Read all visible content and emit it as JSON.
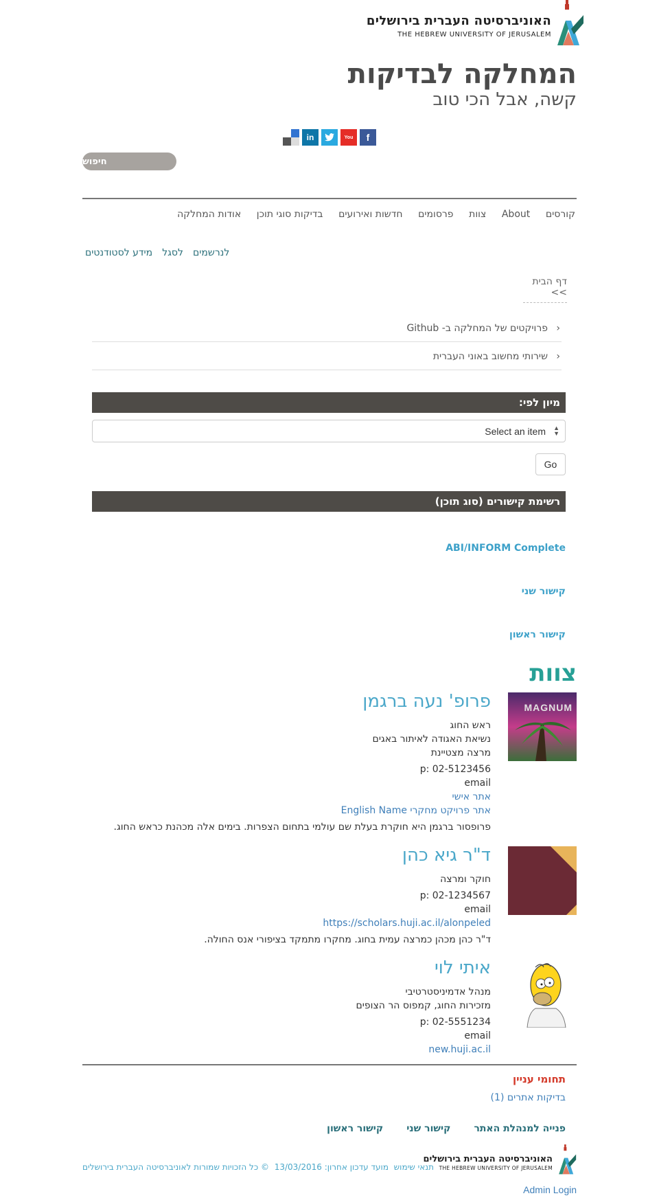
{
  "header": {
    "university_he": "האוניברסיטה העברית בירושלים",
    "university_en": "THE HEBREW UNIVERSITY OF JERUSALEM",
    "site_title": "המחלקה לבדיקות",
    "site_slogan": "קשה, אבל הכי טוב",
    "social": [
      {
        "icon": "facebook-icon",
        "glyph": "f",
        "color": "#3b5998"
      },
      {
        "icon": "youtube-icon",
        "glyph": "▶",
        "color": "#e52d27"
      },
      {
        "icon": "twitter-icon",
        "glyph": "t",
        "color": "#2aa9e0"
      },
      {
        "icon": "linkedin-icon",
        "glyph": "in",
        "color": "#0e76a8"
      },
      {
        "icon": "delicious-icon",
        "glyph": "",
        "color": "#3274d1"
      }
    ],
    "search_label": "חיפוש"
  },
  "main_nav": [
    "אודות המחלקה",
    "בדיקות סוגי תוכן",
    "חדשות ואירועים",
    "פרסומים",
    "צוות",
    "About",
    "קורסים"
  ],
  "secondary_nav": [
    "לנרשמים",
    "לסגל",
    "מידע לסטודנטים"
  ],
  "breadcrumb": "דף הבית >>",
  "side_menu": [
    "פרויקטים של המחלקה ב- Github",
    "שירותי מחשוב באוני העברית"
  ],
  "filter": {
    "title": "מיון לפי:",
    "select_value": "Select an item",
    "go_label": "Go"
  },
  "links_section": {
    "title": "רשימת קישורים (סוג תוכן)",
    "items": [
      "ABI/INFORM Complete",
      "קישור שני",
      "קישור ראשון"
    ]
  },
  "team": {
    "title": "צוות",
    "members": [
      {
        "name": "פרופ' נעה ברגמן",
        "photo_caption": "MAGNUM",
        "roles": [
          "ראש החוג",
          "נשיאת האגודה לאיתור באגים",
          "מרצה מצטיינת"
        ],
        "phone": "p: 02-5123456",
        "email": "email",
        "links": [
          "אתר אישי",
          "אתר פרויקט מחקרי English Name"
        ],
        "bio": "פרופסור ברגמן היא חוקרת בעלת שם עולמי בתחום הצפרות. בימים אלה מכהנת כראש החוג."
      },
      {
        "name": "ד\"ר גיא כהן",
        "roles": [
          "חוקר ומרצה"
        ],
        "phone": "p: 02-1234567",
        "email": "email",
        "links": [
          "https://scholars.huji.ac.il/alonpeled"
        ],
        "bio": "ד\"ר כהן מכהן כמרצה עמית בחוג. מחקרו מתמקד בציפורי אנס החולה."
      },
      {
        "name": "איתי לוי",
        "roles": [
          "מנהל אדמיניסטרטיבי",
          "מזכירות החוג, קמפוס הר הצופים"
        ],
        "phone": "p: 02-5551234",
        "email": "email",
        "links": [
          "new.huji.ac.il"
        ]
      }
    ]
  },
  "interests": {
    "title": "תחומי עניין",
    "item": "בדיקות אתרים (1)"
  },
  "footer": {
    "links": [
      "קישור ראשון",
      "קישור שני",
      "פנייה למנהלת האתר"
    ],
    "university_he": "האוניברסיטה העברית בירושלים",
    "university_en": "THE HEBREW UNIVERSITY OF JERUSALEM",
    "copyright": "© כל הזכויות שמורות לאוניברסיטה העברית בירושלים",
    "last_update": "מועד עדכון אחרון: 13/03/2016",
    "terms": "תנאי שימוש",
    "admin_login": "Admin Login"
  }
}
